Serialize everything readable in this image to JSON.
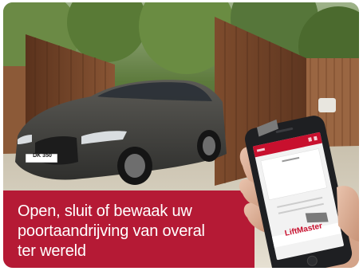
{
  "caption": {
    "lines": [
      "Open, sluit of bewaak uw",
      "poortaandrijving van overal",
      "ter wereld"
    ]
  },
  "car": {
    "plate": "DK 350"
  },
  "phone_app": {
    "brand": "LiftMaster"
  },
  "colors": {
    "caption_bg": "#b51a35",
    "app_accent": "#c8102e",
    "gate_wood": "#7a4a2c"
  }
}
